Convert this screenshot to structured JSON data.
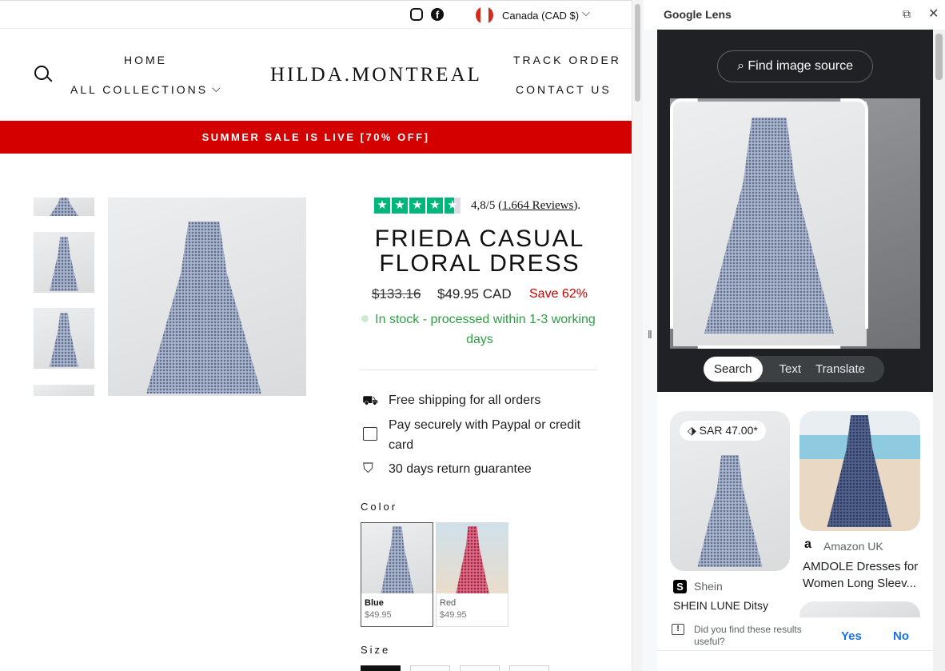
{
  "shop": {
    "currency": "Canada (CAD $)",
    "nav": {
      "home": "HOME",
      "collections": "ALL COLLECTIONS",
      "track": "TRACK ORDER",
      "contact": "CONTACT US"
    },
    "logo": "HILDA.MONTREAL",
    "banner": "SUMMER SALE IS LIVE [70% OFF]",
    "rating": {
      "value": "4,8/5",
      "reviews": "1.664 Reviews",
      "stars": 4.8,
      "star_color": "#00b67a"
    },
    "product": {
      "title_line1": "FRIEDA CASUAL",
      "title_line2": "FLORAL DRESS",
      "old_price": "$133.16",
      "price": "$49.95 CAD",
      "save": "Save 62%",
      "stock_line1": "In stock - processed within 1-3 working",
      "stock_line2": "days"
    },
    "features": [
      "Free shipping for all orders",
      "Pay securely with Paypal or credit",
      "card",
      "30 days return guarantee"
    ],
    "color_label": "Color",
    "colors": [
      {
        "name": "Blue",
        "price": "$49.95"
      },
      {
        "name": "Red",
        "price": "$49.95"
      }
    ],
    "size_label": "Size"
  },
  "lens": {
    "title": "Google Lens",
    "find_source": "Find image source",
    "tabs": [
      "Search",
      "Text",
      "Translate"
    ],
    "results": [
      {
        "price": "SAR 47.00*",
        "source": "Shein",
        "title": "SHEIN LUNE Ditsy"
      },
      {
        "source": "Amazon UK",
        "title_line1": "AMDOLE Dresses for",
        "title_line2": "Women Long Sleev..."
      }
    ],
    "feedback": {
      "question_line1": "Did you find these results",
      "question_line2": "useful?",
      "yes": "Yes",
      "no": "No"
    }
  }
}
